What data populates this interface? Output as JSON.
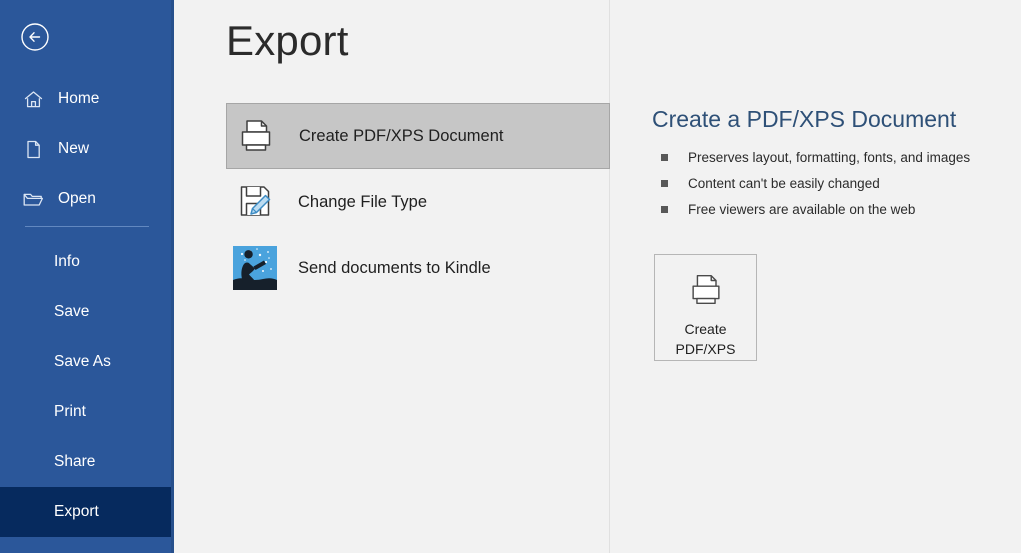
{
  "app": {
    "title": "Export",
    "accent_blue": "#2b579a",
    "active_blue": "#062a5e",
    "heading_blue": "#2e5077",
    "selected_gray": "#c6c6c6",
    "canvas_gray": "#f2f2f2"
  },
  "sidebar": {
    "back_label": "Back",
    "back_icon": "circle-back-arrow-icon",
    "top_items": [
      {
        "label": "Home",
        "icon": "home-icon"
      },
      {
        "label": "New",
        "icon": "new-document-icon"
      },
      {
        "label": "Open",
        "icon": "open-folder-icon"
      }
    ],
    "bottom_items": [
      {
        "label": "Info",
        "active": false
      },
      {
        "label": "Save",
        "active": false
      },
      {
        "label": "Save As",
        "active": false
      },
      {
        "label": "Print",
        "active": false
      },
      {
        "label": "Share",
        "active": false
      },
      {
        "label": "Export",
        "active": true
      }
    ]
  },
  "main": {
    "page_title": "Export",
    "options": [
      {
        "label": "Create PDF/XPS Document",
        "icon": "printer-document-icon",
        "selected": true
      },
      {
        "label": "Change File Type",
        "icon": "save-pencil-icon",
        "selected": false
      },
      {
        "label": "Send documents to Kindle",
        "icon": "kindle-logo-icon",
        "selected": false
      }
    ]
  },
  "detail": {
    "title": "Create a PDF/XPS Document",
    "bullets": [
      "Preserves layout, formatting, fonts, and images",
      "Content can't be easily changed",
      "Free viewers are available on the web"
    ],
    "command_button": {
      "line1": "Create",
      "line2": "PDF/XPS",
      "icon": "printer-document-icon"
    }
  }
}
